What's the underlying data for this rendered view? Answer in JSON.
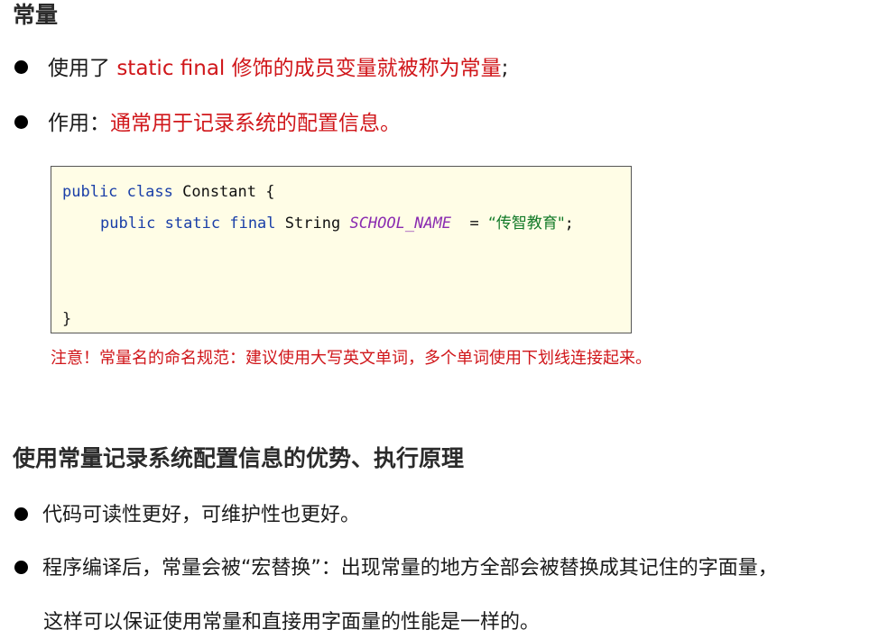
{
  "section1": {
    "title": "常量",
    "bullets": [
      {
        "prefix": "使用了 ",
        "highlight": "static final 修饰的成员变量就被称为常量",
        "suffix": ";"
      },
      {
        "prefix": "作用：",
        "highlight": "通常用于记录系统的配置信息。",
        "suffix": ""
      }
    ],
    "code": {
      "line1": {
        "kw1": "public",
        "kw2": "class",
        "name": "Constant {"
      },
      "line2": {
        "kw1": "public",
        "kw2": "static",
        "kw3": "final",
        "type": "String",
        "const": "SCHOOL_NAME",
        "eq": " = ",
        "str": "“传智教育\"",
        "end": ";"
      },
      "line3": "}"
    },
    "note": "注意！常量名的命名规范：建议使用大写英文单词，多个单词使用下划线连接起来。"
  },
  "section2": {
    "title": "使用常量记录系统配置信息的优势、执行原理",
    "bullets": [
      "代码可读性更好，可维护性也更好。",
      "程序编译后，常量会被“宏替换”：出现常量的地方全部会被替换成其记住的字面量，"
    ],
    "continuation": "这样可以保证使用常量和直接用字面量的性能是一样的。"
  },
  "colors": {
    "highlight": "#d0161a",
    "keyword": "#1a3fa8",
    "constant": "#8a2bb0",
    "string": "#127a28",
    "code_bg": "#fffde6"
  }
}
